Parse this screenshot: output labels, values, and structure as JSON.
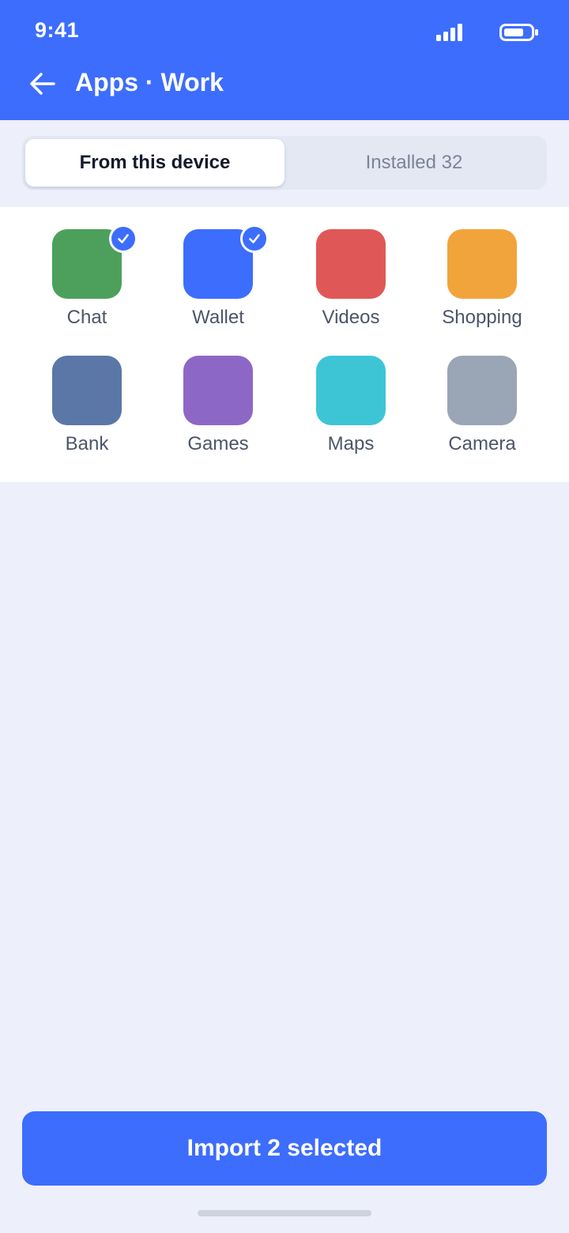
{
  "status_bar": {
    "time": "9:41"
  },
  "header": {
    "title": "Apps · Work",
    "back_icon": "arrow-left-icon"
  },
  "segments": [
    {
      "label": "From this device",
      "active": true
    },
    {
      "label": "Installed 32",
      "active": false
    }
  ],
  "apps": [
    {
      "label": "Chat",
      "color": "#4ca05c",
      "selected": true
    },
    {
      "label": "Wallet",
      "color": "#3d6dfd",
      "selected": true
    },
    {
      "label": "Videos",
      "color": "#e05757",
      "selected": false
    },
    {
      "label": "Shopping",
      "color": "#f2a43c",
      "selected": false
    },
    {
      "label": "Bank",
      "color": "#5b77a8",
      "selected": false
    },
    {
      "label": "Games",
      "color": "#8d67c6",
      "selected": false
    },
    {
      "label": "Maps",
      "color": "#3dc5d6",
      "selected": false
    },
    {
      "label": "Camera",
      "color": "#9aa6b5",
      "selected": false
    }
  ],
  "footer": {
    "import_label": "Import 2 selected"
  },
  "colors": {
    "accent": "#3d6dfd",
    "background": "#edf0fa"
  }
}
